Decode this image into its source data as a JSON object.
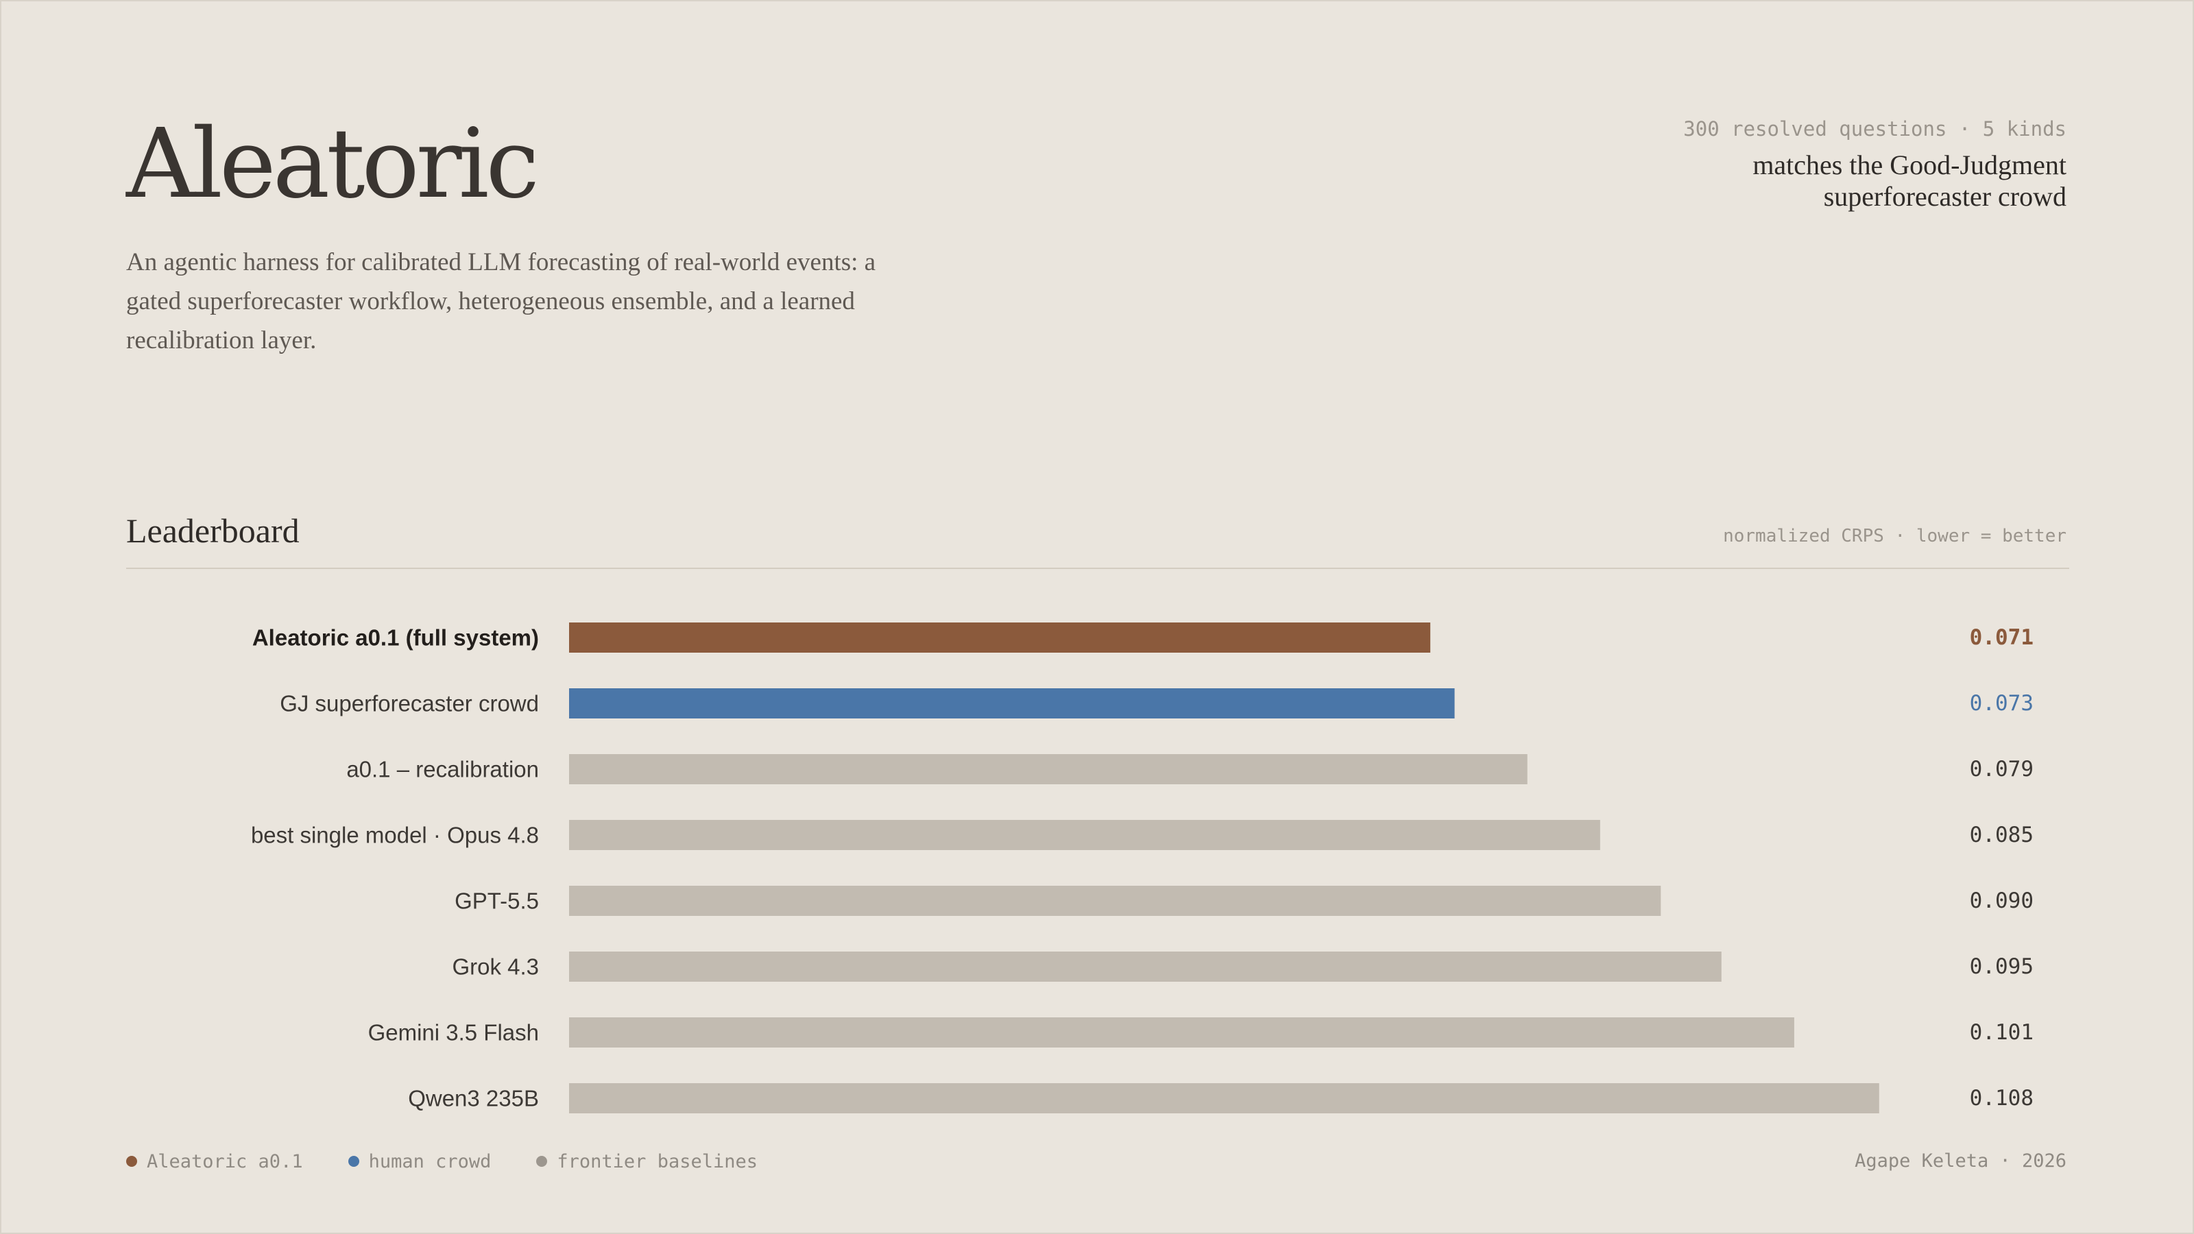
{
  "header": {
    "title": "Aleatoric",
    "subtitle": "An agentic harness for calibrated LLM forecasting of real-world events: a gated superforecaster workflow, heterogeneous ensemble, and a learned recalibration layer.",
    "meta_line": "300 resolved questions · 5 kinds",
    "meta_claim": "matches the Good-Judgment superforecaster crowd"
  },
  "leaderboard": {
    "section_title": "Leaderboard",
    "metric_note": "normalized CRPS · lower = better"
  },
  "colors": {
    "accent": "#8b5a3c",
    "crowd": "#4a76a8",
    "baseline": "#c2bbb1",
    "label_text": "#3d3935",
    "value_text": "#3d3935"
  },
  "chart_data": {
    "type": "bar",
    "orientation": "horizontal",
    "categories": [
      "Aleatoric a0.1 (full system)",
      "GJ superforecaster crowd",
      "a0.1 – recalibration",
      "best single model · Opus 4.8",
      "GPT-5.5",
      "Grok 4.3",
      "Gemini 3.5 Flash",
      "Qwen3 235B"
    ],
    "values": [
      0.071,
      0.073,
      0.079,
      0.085,
      0.09,
      0.095,
      0.101,
      0.108
    ],
    "value_labels": [
      "0.071",
      "0.073",
      "0.079",
      "0.085",
      "0.090",
      "0.095",
      "0.101",
      "0.108"
    ],
    "groups": [
      "aleatoric",
      "crowd",
      "baseline",
      "baseline",
      "baseline",
      "baseline",
      "baseline",
      "baseline"
    ],
    "emphasized": [
      true,
      false,
      false,
      false,
      false,
      false,
      false,
      false
    ],
    "xlim": [
      0,
      0.13
    ],
    "grid": false
  },
  "legend": {
    "placement": "bottom-left",
    "items": [
      {
        "label": "Aleatoric a0.1",
        "group": "aleatoric"
      },
      {
        "label": "human crowd",
        "group": "crowd"
      },
      {
        "label": "frontier baselines",
        "group": "frontier"
      }
    ],
    "dot_colors": {
      "aleatoric": "#8b5a3c",
      "crowd": "#4a76a8",
      "frontier": "#9c968e"
    }
  },
  "footer": {
    "credit": "Agape Keleta · 2026"
  }
}
